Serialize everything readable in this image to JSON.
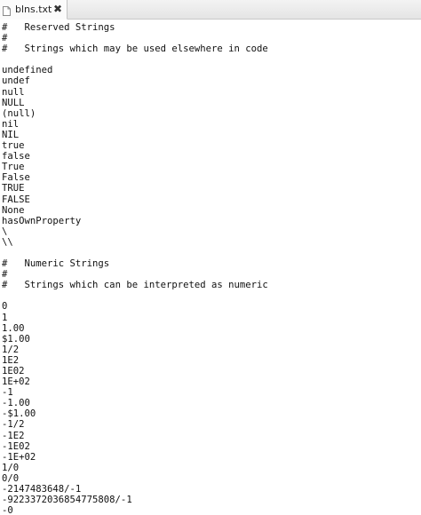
{
  "tab": {
    "filename": "blns.txt",
    "close_glyph": "✖"
  },
  "editor": {
    "lines": [
      "#\tReserved Strings",
      "#",
      "#\tStrings which may be used elsewhere in code",
      "",
      "undefined",
      "undef",
      "null",
      "NULL",
      "(null)",
      "nil",
      "NIL",
      "true",
      "false",
      "True",
      "False",
      "TRUE",
      "FALSE",
      "None",
      "hasOwnProperty",
      "\\",
      "\\\\",
      "",
      "#\tNumeric Strings",
      "#",
      "#\tStrings which can be interpreted as numeric",
      "",
      "0",
      "1",
      "1.00",
      "$1.00",
      "1/2",
      "1E2",
      "1E02",
      "1E+02",
      "-1",
      "-1.00",
      "-$1.00",
      "-1/2",
      "-1E2",
      "-1E02",
      "-1E+02",
      "1/0",
      "0/0",
      "-2147483648/-1",
      "-9223372036854775808/-1",
      "-0"
    ]
  },
  "icons": {
    "file": "text-file-icon",
    "close": "close-icon"
  }
}
